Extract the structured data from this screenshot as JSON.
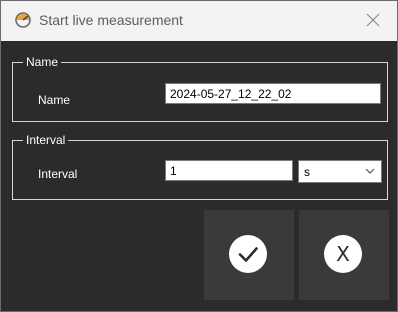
{
  "window": {
    "title": "Start live measurement",
    "app_icon": "gauge-icon",
    "close_icon": "close-icon"
  },
  "name_group": {
    "legend": "Name",
    "label": "Name",
    "value": "2024-05-27_12_22_02"
  },
  "interval_group": {
    "legend": "Interval",
    "label": "Interval",
    "value": "1",
    "unit": "s",
    "unit_icon": "chevron-down-icon"
  },
  "actions": {
    "ok_icon": "checkmark-icon",
    "cancel_glyph": "X"
  },
  "colors": {
    "background": "#2b2b2b",
    "titlebar": "#f3f3f3",
    "button": "#3a3a3a",
    "text": "#ffffff"
  }
}
